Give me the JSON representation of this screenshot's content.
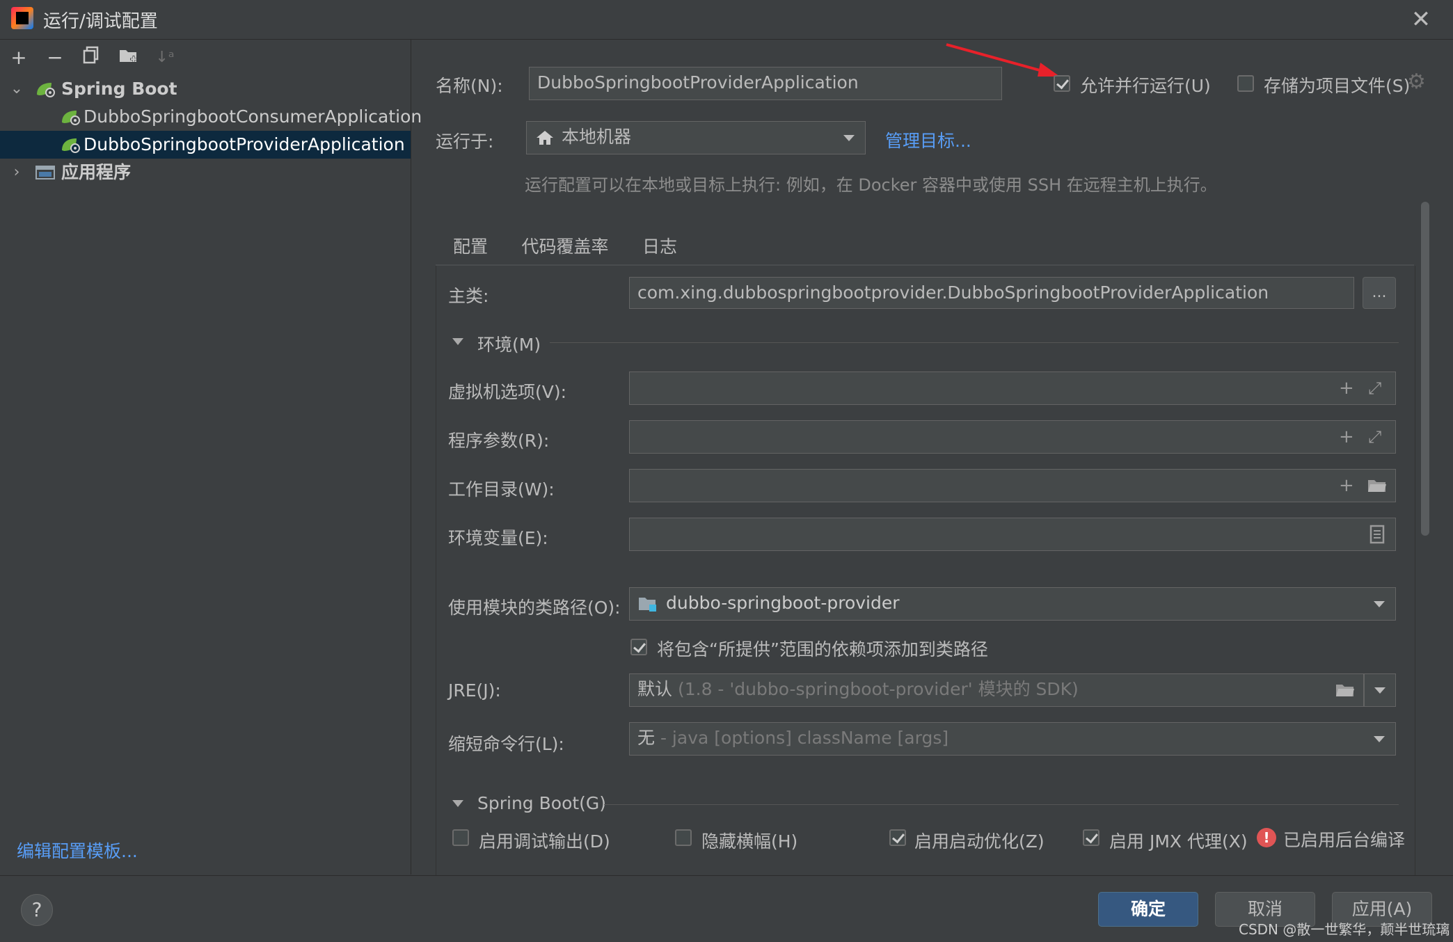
{
  "window": {
    "title": "运行/调试配置",
    "close_icon": "close-icon"
  },
  "toolbar": {
    "add": "+",
    "remove": "−"
  },
  "tree": {
    "group1": {
      "label": "Spring Boot"
    },
    "items": [
      {
        "label": "DubboSpringbootConsumerApplication"
      },
      {
        "label": "DubboSpringbootProviderApplication"
      }
    ],
    "group2": {
      "label": "应用程序"
    }
  },
  "left_footer": {
    "edit_templates": "编辑配置模板..."
  },
  "form": {
    "name_label": "名称(N):",
    "name_value": "DubboSpringbootProviderApplication",
    "allow_parallel": "允许并行运行(U)",
    "store_as_file": "存储为项目文件(S)",
    "run_on_label": "运行于:",
    "run_on_value": "本地机器",
    "manage_targets": "管理目标...",
    "run_hint": "运行配置可以在本地或目标上执行: 例如，在 Docker 容器中或使用 SSH 在远程主机上执行。"
  },
  "tabs": [
    {
      "label": "配置"
    },
    {
      "label": "代码覆盖率"
    },
    {
      "label": "日志"
    }
  ],
  "config": {
    "main_class_label": "主类:",
    "main_class_value": "com.xing.dubbospringbootprovider.DubboSpringbootProviderApplication",
    "browse": "...",
    "env_section": "环境(M)",
    "vm_options_label": "虚拟机选项(V):",
    "program_args_label": "程序参数(R):",
    "working_dir_label": "工作目录(W):",
    "env_vars_label": "环境变量(E):",
    "module_label": "使用模块的类路径(O):",
    "module_value": "dubbo-springboot-provider",
    "include_provided": "将包含“所提供”范围的依赖项添加到类路径",
    "jre_label": "JRE(J):",
    "jre_default": "默认",
    "jre_detail": "(1.8 - 'dubbo-springboot-provider' 模块的 SDK)",
    "shorten_label": "缩短命令行(L):",
    "shorten_value": "无",
    "shorten_detail": "- java [options] className [args]",
    "springboot_section": "Spring Boot(G)",
    "debug_output": "启用调试输出(D)",
    "hide_banner": "隐藏横幅(H)",
    "launch_opt": "启用启动优化(Z)",
    "jmx_agent": "启用 JMX 代理(X)",
    "bg_compile": "已启用后台编译"
  },
  "buttons": {
    "ok": "确定",
    "cancel": "取消",
    "apply": "应用(A)",
    "help": "?"
  },
  "watermark": "CSDN @散一世繁华，颠半世琉璃",
  "colors": {
    "accent": "#589df6",
    "primary_button": "#365880",
    "background": "#3c3f41",
    "selection": "#0d293e",
    "annotation_arrow": "#e8212a"
  }
}
